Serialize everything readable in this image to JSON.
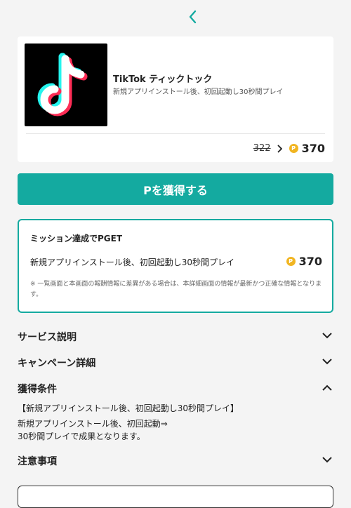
{
  "app": {
    "name": "TikTok ティックトック",
    "description": "新規アプリインストール後、初回起動し30秒間プレイ",
    "old_price": "322",
    "new_price": "370",
    "coin_letter": "P"
  },
  "cta_label": "Pを獲得する",
  "mission": {
    "title": "ミッション達成でPGET",
    "task": "新規アプリインストール後、初回起動し30秒間プレイ",
    "reward": "370",
    "note": "※ 一覧画面と本画面の報酬情報に差異がある場合は、本詳細画面の情報が最新かつ正確な情報となります。"
  },
  "sections": {
    "service": "サービス説明",
    "campaign": "キャンペーン詳細",
    "conditions": "獲得条件",
    "notes": "注意事項"
  },
  "conditions": {
    "head": "【新規アプリインストール後、初回起動し30秒間プレイ】",
    "line1": "新規アプリインストール後、初回起動⇒",
    "line2": "30秒間プレイで成果となります。"
  },
  "colors": {
    "accent": "#14aaa0",
    "coin": "#f1b521"
  }
}
